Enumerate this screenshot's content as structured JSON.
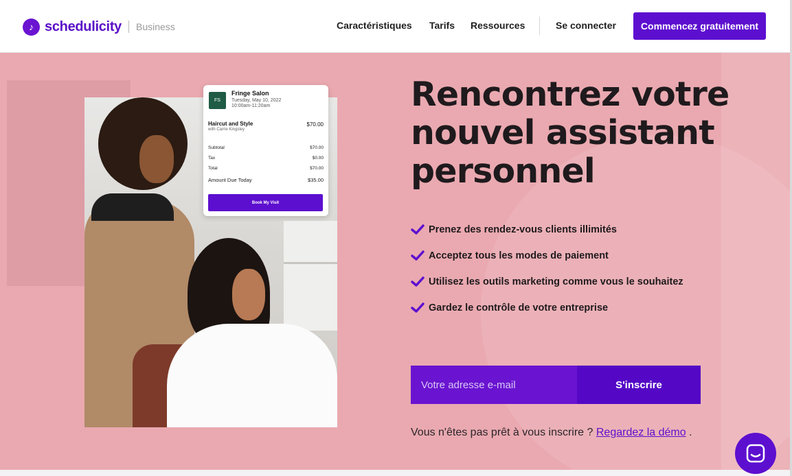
{
  "header": {
    "brand": "schedulicity",
    "brand_sub": "Business",
    "nav": [
      {
        "label": "Caractéristiques"
      },
      {
        "label": "Tarifs"
      },
      {
        "label": "Ressources"
      }
    ],
    "login": "Se connecter",
    "cta": "Commencez gratuitement"
  },
  "receipt": {
    "logo_text": "FS",
    "salon": "Fringe Salon",
    "date": "Tuesday, May 10, 2022",
    "time": "10:00am-11:20am",
    "service": "Haircut and Style",
    "with": "with Carrie Kingsley",
    "service_price": "$70.00",
    "rows": [
      {
        "label": "Subtotal",
        "value": "$70.00"
      },
      {
        "label": "Tax",
        "value": "$0.00"
      },
      {
        "label": "Total",
        "value": "$70.00"
      },
      {
        "label": "Amount Due Today",
        "value": "$35.00"
      }
    ],
    "button": "Book My Visit"
  },
  "hero": {
    "headline": "Rencontrez votre nouvel assistant personnel",
    "features": [
      "Prenez des rendez-vous clients illimités",
      "Acceptez tous les modes de paiement",
      "Utilisez les outils marketing comme vous le souhaitez",
      "Gardez le contrôle de votre entreprise"
    ],
    "email_placeholder": "Votre adresse e-mail",
    "submit": "S'inscrire",
    "demo_prefix": "Vous n'êtes pas prêt à vous inscrire ? ",
    "demo_link": "Regardez la démo",
    "demo_suffix": " ."
  },
  "icons": {
    "check": "checkmark-icon",
    "chat": "chat-icon"
  },
  "colors": {
    "brand_purple": "#5d0fcf",
    "hero_pink": "#eaa9b0",
    "text_dark": "#1f1a1d"
  }
}
